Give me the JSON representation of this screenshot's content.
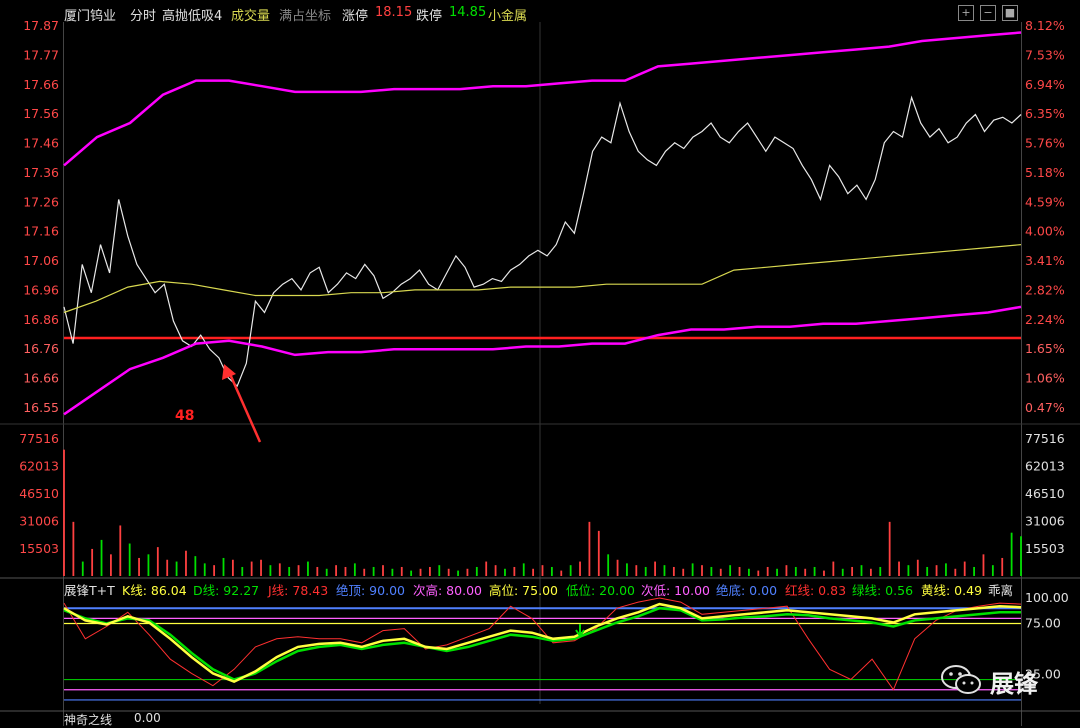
{
  "header": {
    "stock_name": "厦门钨业",
    "mode": "分时",
    "strategy": "高抛低吸4",
    "volume_label": "成交量",
    "coord_label": "满占坐标",
    "limit_up_label": "涨停",
    "limit_up_value": "18.15",
    "limit_down_label": "跌停",
    "limit_down_value": "14.85",
    "sector": "小金属",
    "zoom_in": "+",
    "zoom_out": "−"
  },
  "indicator_header": {
    "name": "展锋T+T",
    "k": "K线: 86.04",
    "d": "D线: 92.27",
    "j": "J线: 78.43",
    "top": "绝顶: 90.00",
    "sub_high": "次高: 80.00",
    "high": "高位: 75.00",
    "low": "低位: 20.00",
    "sub_low": "次低: 10.00",
    "bottom": "绝底: 0.00",
    "red": "红线: 0.83",
    "green": "绿线: 0.56",
    "yellow": "黄线: 0.49",
    "tail": "乖离"
  },
  "footer": {
    "label": "神奇之线",
    "value": "0.00"
  },
  "watermark": {
    "text": "展锋"
  },
  "annotation": {
    "marker": "48"
  },
  "colors": {
    "price_up": "#ff4040",
    "price_down": "#00e000",
    "band": "#ff00ff",
    "avg": "#d8d850",
    "limit_line": "#ff2020",
    "k_line": "#ffff40",
    "d_line": "#00e000",
    "j_line": "#ff3030",
    "top_line": "#5080ff"
  },
  "chart_data": [
    {
      "type": "line",
      "title": "分时",
      "y_left_ticks": [
        "17.87",
        "17.77",
        "17.66",
        "17.56",
        "17.46",
        "17.36",
        "17.26",
        "17.16",
        "17.06",
        "16.96",
        "16.86",
        "16.76",
        "16.66",
        "16.55"
      ],
      "y_right_ticks": [
        "8.12%",
        "7.53%",
        "6.94%",
        "6.35%",
        "5.76%",
        "5.18%",
        "4.59%",
        "4.00%",
        "3.41%",
        "2.82%",
        "2.24%",
        "1.65%",
        "1.06%",
        "0.47%"
      ],
      "ylim": [
        16.5,
        17.9
      ],
      "reference_price": 16.79,
      "series": [
        {
          "name": "price",
          "values": [
            16.9,
            16.77,
            17.05,
            16.95,
            17.12,
            17.02,
            17.28,
            17.15,
            17.05,
            17.0,
            16.95,
            16.98,
            16.85,
            16.78,
            16.76,
            16.8,
            16.75,
            16.72,
            16.65,
            16.62,
            16.7,
            16.92,
            16.88,
            16.95,
            16.98,
            17.0,
            16.96,
            17.02,
            17.04,
            16.95,
            16.98,
            17.02,
            17.0,
            17.05,
            17.01,
            16.93,
            16.95,
            16.98,
            17.0,
            17.03,
            16.98,
            16.96,
            17.02,
            17.08,
            17.04,
            16.97,
            16.98,
            17.0,
            16.99,
            17.03,
            17.05,
            17.08,
            17.1,
            17.08,
            17.12,
            17.2,
            17.16,
            17.3,
            17.45,
            17.5,
            17.48,
            17.62,
            17.52,
            17.45,
            17.42,
            17.4,
            17.45,
            17.48,
            17.46,
            17.5,
            17.52,
            17.55,
            17.5,
            17.48,
            17.52,
            17.55,
            17.5,
            17.45,
            17.5,
            17.48,
            17.46,
            17.4,
            17.35,
            17.28,
            17.4,
            17.36,
            17.3,
            17.33,
            17.28,
            17.35,
            17.48,
            17.52,
            17.5,
            17.64,
            17.55,
            17.5,
            17.53,
            17.48,
            17.5,
            17.55,
            17.58,
            17.52,
            17.56,
            17.57,
            17.55,
            17.58
          ]
        },
        {
          "name": "average",
          "values": [
            16.88,
            16.92,
            16.97,
            16.99,
            16.98,
            16.96,
            16.94,
            16.94,
            16.94,
            16.95,
            16.95,
            16.96,
            16.96,
            16.96,
            16.97,
            16.97,
            16.97,
            16.98,
            16.98,
            16.98,
            16.98,
            17.03,
            17.04,
            17.05,
            17.06,
            17.07,
            17.08,
            17.09,
            17.1,
            17.11,
            17.12
          ]
        },
        {
          "name": "upper_band",
          "values": [
            17.4,
            17.5,
            17.55,
            17.65,
            17.7,
            17.7,
            17.68,
            17.66,
            17.66,
            17.66,
            17.67,
            17.67,
            17.67,
            17.68,
            17.68,
            17.69,
            17.7,
            17.7,
            17.75,
            17.76,
            17.77,
            17.78,
            17.79,
            17.8,
            17.81,
            17.82,
            17.84,
            17.85,
            17.86,
            17.87
          ]
        },
        {
          "name": "lower_band",
          "values": [
            16.52,
            16.6,
            16.68,
            16.72,
            16.77,
            16.78,
            16.76,
            16.73,
            16.74,
            16.74,
            16.75,
            16.75,
            16.75,
            16.75,
            16.76,
            16.76,
            16.77,
            16.77,
            16.8,
            16.82,
            16.82,
            16.83,
            16.83,
            16.84,
            16.84,
            16.85,
            16.86,
            16.87,
            16.88,
            16.9
          ]
        }
      ]
    },
    {
      "type": "bar",
      "title": "成交量",
      "y_ticks": [
        "77516",
        "62013",
        "46510",
        "31006",
        "15503"
      ],
      "ylim": [
        0,
        82000
      ],
      "values": [
        70000,
        30000,
        8000,
        15000,
        20000,
        12000,
        28000,
        18000,
        10000,
        12000,
        16000,
        9000,
        8000,
        14000,
        11000,
        7000,
        6000,
        10000,
        9000,
        5000,
        8000,
        9000,
        6000,
        7000,
        5000,
        6000,
        8000,
        5000,
        4000,
        6000,
        5000,
        7000,
        4000,
        5000,
        6000,
        4000,
        5000,
        3000,
        4000,
        5000,
        6000,
        4000,
        3000,
        4000,
        5000,
        8000,
        6000,
        4000,
        5000,
        7000,
        4000,
        6000,
        5000,
        3000,
        6000,
        8000,
        30000,
        25000,
        12000,
        9000,
        7000,
        6000,
        5000,
        8000,
        6000,
        5000,
        4000,
        7000,
        6000,
        5000,
        4000,
        6000,
        5000,
        4000,
        3000,
        5000,
        4000,
        6000,
        5000,
        4000,
        5000,
        3000,
        8000,
        4000,
        5000,
        6000,
        4000,
        5000,
        30000,
        8000,
        6000,
        9000,
        5000,
        6000,
        7000,
        4000,
        8000,
        5000,
        12000,
        6000,
        10000,
        24000,
        22000
      ],
      "colors": [
        "up",
        "up",
        "down",
        "up",
        "down",
        "up",
        "up",
        "down",
        "up",
        "down",
        "up",
        "up",
        "down",
        "up",
        "down",
        "down",
        "up",
        "down",
        "up",
        "down",
        "up",
        "up",
        "down",
        "up",
        "down",
        "up",
        "down",
        "up",
        "down",
        "up",
        "up",
        "down",
        "up",
        "down",
        "up",
        "down",
        "up",
        "down",
        "up",
        "up",
        "down",
        "up",
        "down",
        "up",
        "down",
        "up",
        "up",
        "down",
        "up",
        "down",
        "up",
        "up",
        "down",
        "up",
        "down",
        "up",
        "up",
        "up",
        "down",
        "up",
        "down",
        "up",
        "down",
        "up",
        "down",
        "up",
        "up",
        "down",
        "up",
        "down",
        "up",
        "down",
        "up",
        "down",
        "up",
        "up",
        "down",
        "up",
        "down",
        "up",
        "down",
        "up",
        "up",
        "down",
        "up",
        "down",
        "up",
        "down",
        "up",
        "up",
        "down",
        "up",
        "down",
        "up",
        "down",
        "up",
        "up",
        "down",
        "up",
        "down",
        "up",
        "down",
        "down"
      ]
    },
    {
      "type": "line",
      "title": "展锋T+T",
      "y_ticks": [
        "100.00",
        "75.00",
        "25.00"
      ],
      "ylim": [
        -4,
        100
      ],
      "reference_levels": [
        {
          "name": "绝顶",
          "value": 90
        },
        {
          "name": "次高",
          "value": 80
        },
        {
          "name": "高位",
          "value": 75
        },
        {
          "name": "低位",
          "value": 20
        },
        {
          "name": "次低",
          "value": 10
        },
        {
          "name": "绝底",
          "value": 0
        }
      ],
      "series": [
        {
          "name": "K线",
          "values": [
            90,
            78,
            74,
            82,
            76,
            60,
            42,
            26,
            18,
            28,
            42,
            52,
            55,
            56,
            52,
            58,
            60,
            52,
            50,
            56,
            62,
            68,
            66,
            60,
            62,
            72,
            80,
            86,
            94,
            90,
            80,
            82,
            84,
            86,
            88,
            86,
            84,
            82,
            80,
            76,
            84,
            86,
            88,
            90,
            92,
            91
          ]
        },
        {
          "name": "D线",
          "values": [
            88,
            80,
            75,
            80,
            78,
            64,
            46,
            30,
            20,
            26,
            38,
            48,
            52,
            54,
            50,
            54,
            56,
            52,
            48,
            52,
            58,
            64,
            62,
            58,
            60,
            68,
            76,
            82,
            90,
            88,
            78,
            79,
            81,
            82,
            84,
            83,
            80,
            78,
            76,
            72,
            78,
            80,
            82,
            84,
            86,
            86
          ]
        },
        {
          "name": "J线",
          "values": [
            95,
            60,
            72,
            86,
            64,
            40,
            26,
            14,
            30,
            52,
            60,
            62,
            60,
            60,
            56,
            68,
            70,
            50,
            54,
            62,
            70,
            92,
            80,
            56,
            58,
            70,
            90,
            96,
            100,
            96,
            84,
            86,
            88,
            90,
            92,
            60,
            30,
            20,
            40,
            10,
            60,
            78,
            88,
            92,
            95,
            94
          ]
        }
      ]
    }
  ]
}
